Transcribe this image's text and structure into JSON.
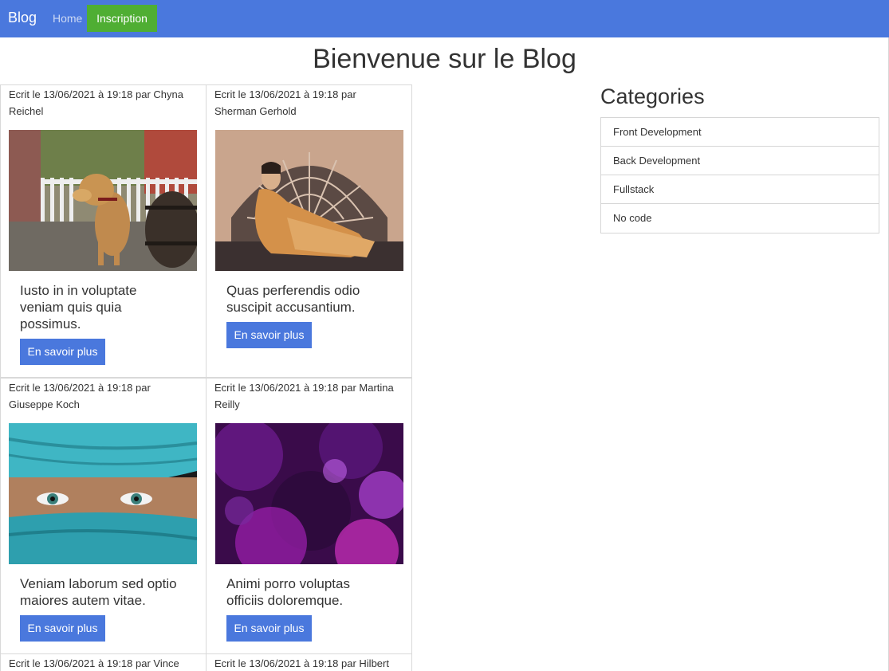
{
  "navbar": {
    "brand": "Blog",
    "home": "Home",
    "signup": "Inscription"
  },
  "page_title": "Bienvenue sur le Blog",
  "posts": [
    {
      "meta": "Ecrit le 13/06/2021 à 19:18 par Chyna Reichel",
      "title": "Iusto in in voluptate veniam quis quia possimus.",
      "button": "En savoir plus",
      "image": "dog-on-porch"
    },
    {
      "meta": "Ecrit le 13/06/2021 à 19:18 par Sherman Gerhold",
      "title": "Quas perferendis odio suscipit accusantium.",
      "button": "En savoir plus",
      "image": "reclining-woman-painting"
    },
    {
      "meta": "Ecrit le 13/06/2021 à 19:18 par Giuseppe Koch",
      "title": "Veniam laborum sed optio maiores autem vitae.",
      "button": "En savoir plus",
      "image": "person-in-blue-veil"
    },
    {
      "meta": "Ecrit le 13/06/2021 à 19:18 par Martina Reilly",
      "title": "Animi porro voluptas officiis doloremque.",
      "button": "En savoir plus",
      "image": "purple-abstract"
    },
    {
      "meta": "Ecrit le 13/06/2021 à 19:18 par Vince"
    },
    {
      "meta": "Ecrit le 13/06/2021 à 19:18 par Hilbert"
    }
  ],
  "sidebar": {
    "title": "Categories",
    "items": [
      "Front Development",
      "Back Development",
      "Fullstack",
      "No code"
    ]
  },
  "colors": {
    "primary": "#4a78dd",
    "success": "#4fae33"
  }
}
